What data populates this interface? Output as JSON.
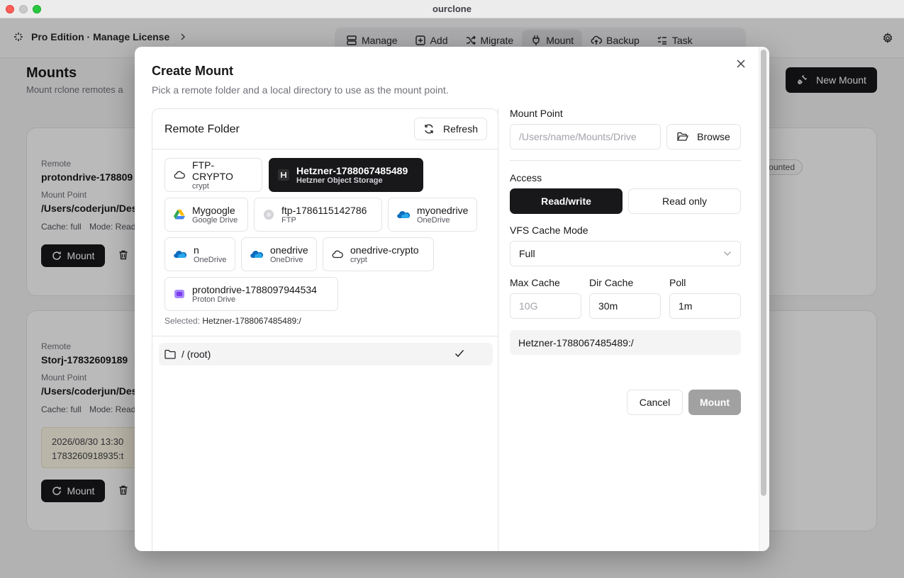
{
  "window": {
    "title": "ourclone"
  },
  "topbar": {
    "pro_label": "Pro Edition · Manage License",
    "nav": [
      {
        "label": "Manage",
        "icon": "server-icon"
      },
      {
        "label": "Add",
        "icon": "plus-square-icon"
      },
      {
        "label": "Migrate",
        "icon": "shuffle-icon"
      },
      {
        "label": "Mount",
        "icon": "plug-icon",
        "active": true
      },
      {
        "label": "Backup",
        "icon": "cloud-upload-icon"
      },
      {
        "label": "Task",
        "icon": "list-checks-icon"
      }
    ]
  },
  "page": {
    "title": "Mounts",
    "subtitle": "Mount rclone remotes a",
    "new_mount_label": "New Mount",
    "cards": [
      {
        "remote_label": "Remote",
        "remote": "protondrive-178809",
        "mountpoint_label": "Mount Point",
        "mountpoint": "/Users/coderjun/Des",
        "cache": "Cache: full",
        "mode": "Mode: Read",
        "status": "Unmounted",
        "mount_label": "Mount"
      },
      {
        "remote_label": "Remote",
        "remote": "Storj-17832609189",
        "mountpoint_label": "Mount Point",
        "mountpoint": "/Users/coderjun/Des",
        "cache": "Cache: full",
        "mode": "Mode: Read",
        "log_line1": "2026/08/30 13:30",
        "log_line2": "1783260918935:t",
        "mount_label": "Mount"
      }
    ]
  },
  "modal": {
    "title": "Create Mount",
    "subtitle": "Pick a remote folder and a local directory to use as the mount point.",
    "remote_folder": {
      "title": "Remote Folder",
      "refresh_label": "Refresh",
      "remotes": [
        {
          "name": "FTP-CRYPTO",
          "type": "crypt",
          "icon": "cloud-outline-icon"
        },
        {
          "name": "Hetzner-1788067485489",
          "type": "Hetzner Object Storage",
          "icon": "hetzner-icon",
          "selected": true
        },
        {
          "name": "Mygoogle",
          "type": "Google Drive",
          "icon": "google-drive-icon"
        },
        {
          "name": "ftp-1786115142786",
          "type": "FTP",
          "icon": "ftp-icon"
        },
        {
          "name": "myonedrive",
          "type": "OneDrive",
          "icon": "onedrive-icon"
        },
        {
          "name": "n",
          "type": "OneDrive",
          "icon": "onedrive-icon"
        },
        {
          "name": "onedrive",
          "type": "OneDrive",
          "icon": "onedrive-icon"
        },
        {
          "name": "onedrive-crypto",
          "type": "crypt",
          "icon": "cloud-outline-icon"
        },
        {
          "name": "protondrive-1788097944534",
          "type": "Proton Drive",
          "icon": "proton-drive-icon"
        }
      ],
      "selected_label": "Selected:",
      "selected_value": "Hetzner-1788067485489:/",
      "folders": [
        {
          "name": "/ (root)",
          "checked": true
        }
      ]
    },
    "mount_point": {
      "label": "Mount Point",
      "placeholder": "/Users/name/Mounts/Drive",
      "browse_label": "Browse"
    },
    "access": {
      "label": "Access",
      "options": [
        "Read/write",
        "Read only"
      ],
      "selected": "Read/write"
    },
    "vfs": {
      "label": "VFS Cache Mode",
      "value": "Full"
    },
    "max_cache": {
      "label": "Max Cache",
      "placeholder": "10G"
    },
    "dir_cache": {
      "label": "Dir Cache",
      "value": "30m"
    },
    "poll": {
      "label": "Poll",
      "value": "1m"
    },
    "summary": "Hetzner-1788067485489:/",
    "cancel_label": "Cancel",
    "submit_label": "Mount"
  }
}
